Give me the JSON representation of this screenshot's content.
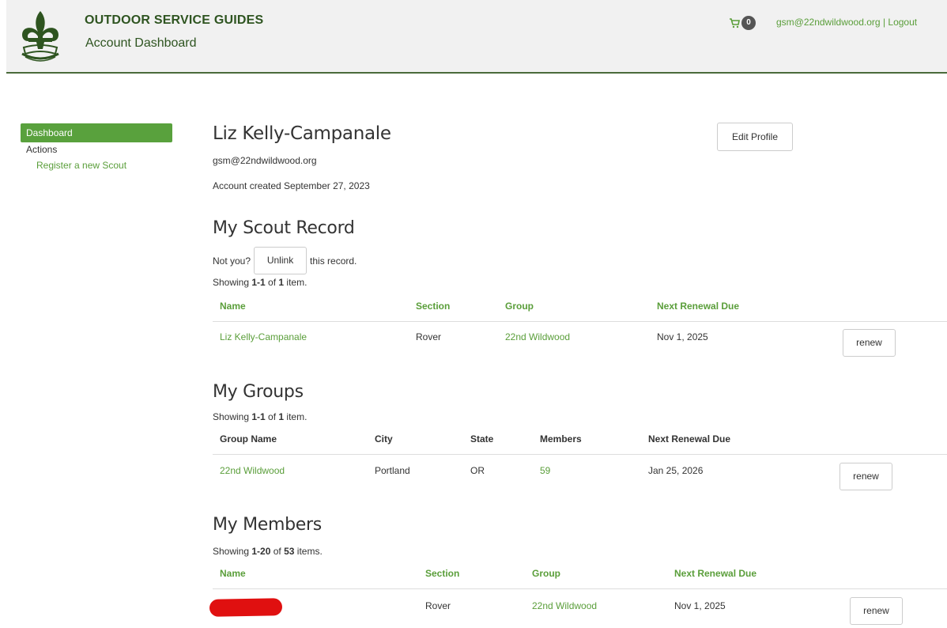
{
  "header": {
    "title": "OUTDOOR SERVICE GUIDES",
    "subtitle": "Account Dashboard",
    "cart_count": "0",
    "user_email": "gsm@22ndwildwood.org",
    "separator": "|",
    "logout": "Logout"
  },
  "sidebar": {
    "active": "Dashboard",
    "heading": "Actions",
    "link": "Register a new Scout"
  },
  "profile": {
    "name": "Liz Kelly-Campanale",
    "email": "gsm@22ndwildwood.org",
    "created": "Account created September 27, 2023",
    "edit_button": "Edit Profile"
  },
  "scout_record": {
    "title": "My Scout Record",
    "not_you": "Not you?",
    "unlink": "Unlink",
    "this_record": "this record.",
    "showing_prefix": "Showing ",
    "showing_range": "1-1",
    "showing_of": " of ",
    "showing_total": "1",
    "showing_suffix": " item.",
    "headers": {
      "name": "Name",
      "section": "Section",
      "group": "Group",
      "renewal": "Next Renewal Due"
    },
    "row": {
      "name": "Liz Kelly-Campanale",
      "section": "Rover",
      "group": "22nd Wildwood",
      "renewal": "Nov 1, 2025",
      "button": "renew"
    }
  },
  "groups": {
    "title": "My Groups",
    "showing_prefix": "Showing ",
    "showing_range": "1-1",
    "showing_of": " of ",
    "showing_total": "1",
    "showing_suffix": " item.",
    "headers": {
      "name": "Group Name",
      "city": "City",
      "state": "State",
      "members": "Members",
      "renewal": "Next Renewal Due"
    },
    "row": {
      "name": "22nd Wildwood",
      "city": "Portland",
      "state": "OR",
      "members": "59",
      "renewal": "Jan 25, 2026",
      "button": "renew"
    }
  },
  "members": {
    "title": "My Members",
    "showing_prefix": "Showing ",
    "showing_range": "1-20",
    "showing_of": " of ",
    "showing_total": "53",
    "showing_suffix": " items.",
    "headers": {
      "name": "Name",
      "section": "Section",
      "group": "Group",
      "renewal": "Next Renewal Due"
    },
    "row": {
      "section": "Rover",
      "group": "22nd Wildwood",
      "renewal": "Nov 1, 2025",
      "button": "renew"
    }
  },
  "colors": {
    "brand_green": "#2e5420",
    "link_green": "#5a9e3a",
    "active_green": "#59a13d",
    "redaction": "#e01010"
  }
}
